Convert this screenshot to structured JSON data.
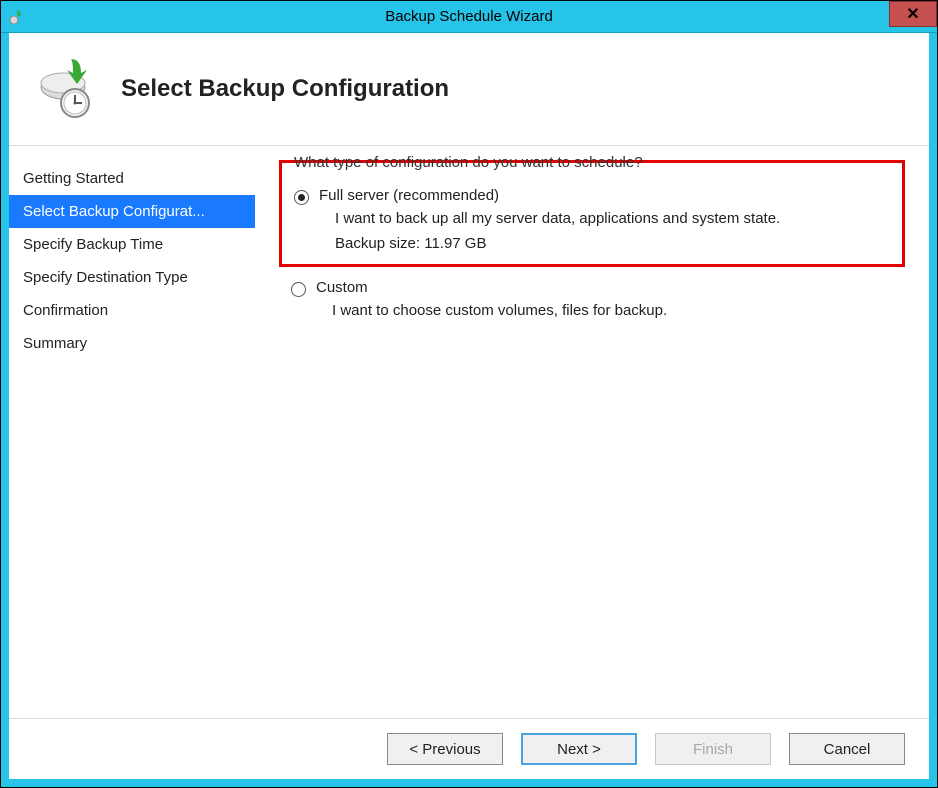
{
  "window": {
    "title": "Backup Schedule Wizard"
  },
  "header": {
    "heading": "Select Backup Configuration"
  },
  "sidebar": {
    "steps": [
      {
        "label": "Getting Started",
        "active": false
      },
      {
        "label": "Select Backup Configurat...",
        "active": true
      },
      {
        "label": "Specify Backup Time",
        "active": false
      },
      {
        "label": "Specify Destination Type",
        "active": false
      },
      {
        "label": "Confirmation",
        "active": false
      },
      {
        "label": "Summary",
        "active": false
      }
    ]
  },
  "content": {
    "question": "What type of configuration do you want to schedule?",
    "options": {
      "full": {
        "title": "Full server (recommended)",
        "desc": "I want to back up all my server data, applications and system state.",
        "size_label": "Backup size: 11.97 GB",
        "checked": true
      },
      "custom": {
        "title": "Custom",
        "desc": "I want to choose custom volumes, files for backup.",
        "checked": false
      }
    }
  },
  "footer": {
    "previous": "< Previous",
    "next": "Next >",
    "finish": "Finish",
    "cancel": "Cancel"
  }
}
